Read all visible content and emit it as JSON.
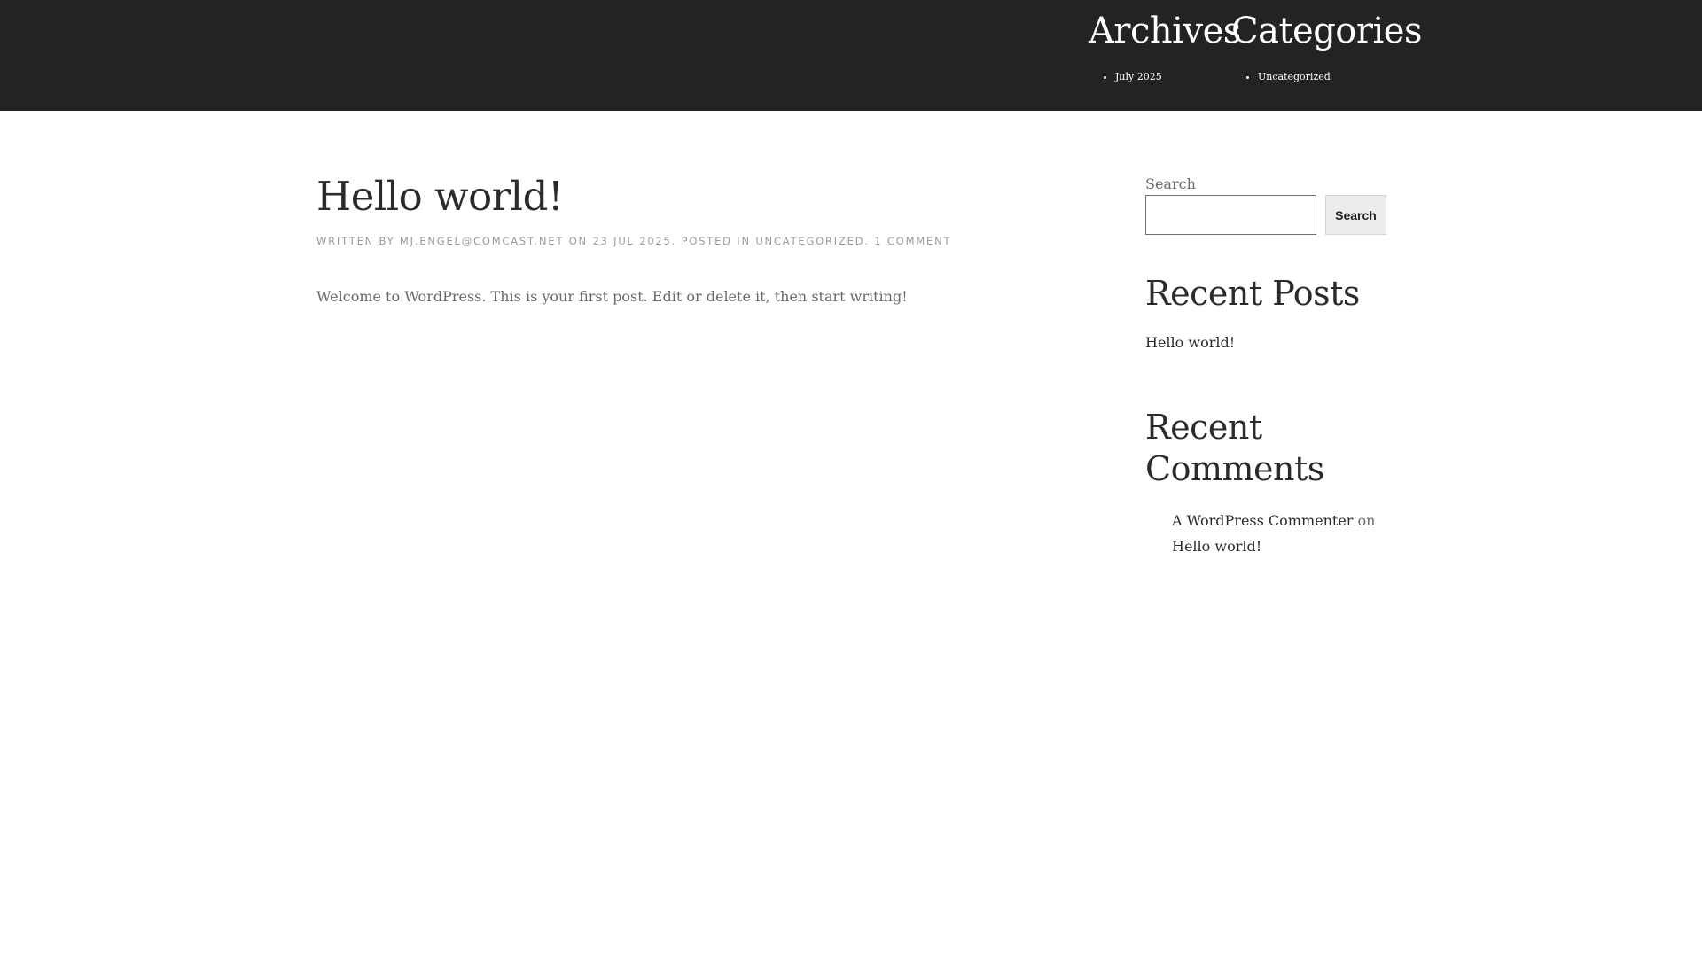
{
  "header": {
    "archives": {
      "title": "Archives",
      "items": [
        {
          "label": "July 2025"
        }
      ]
    },
    "categories": {
      "title": "Categories",
      "items": [
        {
          "label": "Uncategorized"
        }
      ]
    }
  },
  "post": {
    "title": "Hello world!",
    "meta": {
      "written_by_prefix": "Written by",
      "author": "mj.engel@comcast.net",
      "on_word": "on",
      "date": "23 Jul 2025",
      "posted_in_prefix": ". Posted in",
      "category": "Uncategorized",
      "separator": ".",
      "comments": "1 Comment"
    },
    "body": "Welcome to WordPress. This is your first post. Edit or delete it, then start writing!"
  },
  "sidebar": {
    "search": {
      "label": "Search",
      "placeholder": "",
      "value": "",
      "button_label": "Search"
    },
    "recent_posts": {
      "title": "Recent Posts",
      "items": [
        {
          "label": "Hello world!"
        }
      ]
    },
    "recent_comments": {
      "title": "Recent Comments",
      "items": [
        {
          "author": "A WordPress Commenter",
          "on_word": "on",
          "post": "Hello world!"
        }
      ]
    }
  },
  "colors": {
    "header_bg": "#232323",
    "page_bg": "#ffffff",
    "heading_text": "#2b2b2b",
    "body_text": "#6a6a6a",
    "meta_text": "#9a9a9a"
  }
}
